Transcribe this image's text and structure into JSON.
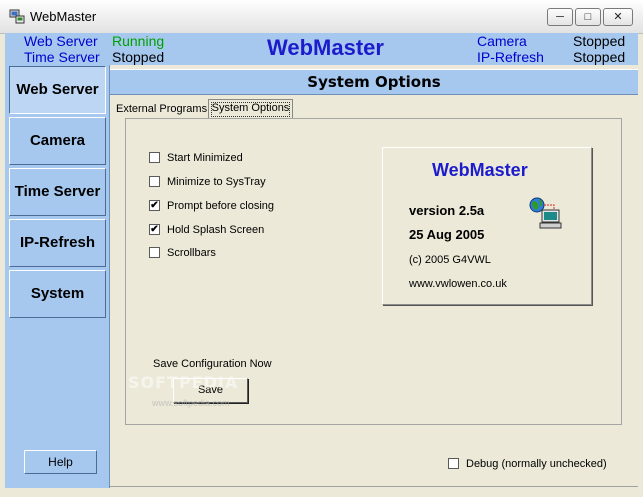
{
  "window": {
    "title": "WebMaster",
    "min_glyph": "─",
    "max_glyph": "□",
    "close_glyph": "✕"
  },
  "status": {
    "web_server_label": "Web Server",
    "web_server_value": "Running",
    "time_server_label": "Time Server",
    "time_server_value": "Stopped",
    "heading": "WebMaster",
    "camera_label": "Camera",
    "camera_value": "Stopped",
    "ip_refresh_label": "IP-Refresh",
    "ip_refresh_value": "Stopped"
  },
  "sidebar": {
    "items": [
      {
        "label": "Web Server",
        "active": true
      },
      {
        "label": "Camera"
      },
      {
        "label": "Time Server"
      },
      {
        "label": "IP-Refresh"
      },
      {
        "label": "System"
      }
    ],
    "help_label": "Help"
  },
  "section": {
    "title": "System Options"
  },
  "tabs": [
    {
      "label": "External Programs"
    },
    {
      "label": "System Options",
      "selected": true
    }
  ],
  "options": [
    {
      "label": "Start Minimized",
      "checked": false
    },
    {
      "label": "Minimize to SysTray",
      "checked": false
    },
    {
      "label": "Prompt before closing",
      "checked": true
    },
    {
      "label": "Hold Splash Screen",
      "checked": true
    },
    {
      "label": "Scrollbars",
      "checked": false
    }
  ],
  "about": {
    "title": "WebMaster",
    "version": "version 2.5a",
    "date": "25 Aug 2005",
    "copyright": "(c) 2005 G4VWL",
    "url": "www.vwlowen.co.uk"
  },
  "save": {
    "caption": "Save Configuration Now",
    "button_label": "Save"
  },
  "debug": {
    "label": "Debug (normally unchecked)",
    "checked": false
  },
  "watermark": {
    "line1": "SOFTPEDIA",
    "line2": "www.softpedia.com"
  },
  "colors": {
    "panel_blue": "#a6c8ef",
    "heading_blue": "#1c1ccc",
    "running_green": "#00a000"
  }
}
